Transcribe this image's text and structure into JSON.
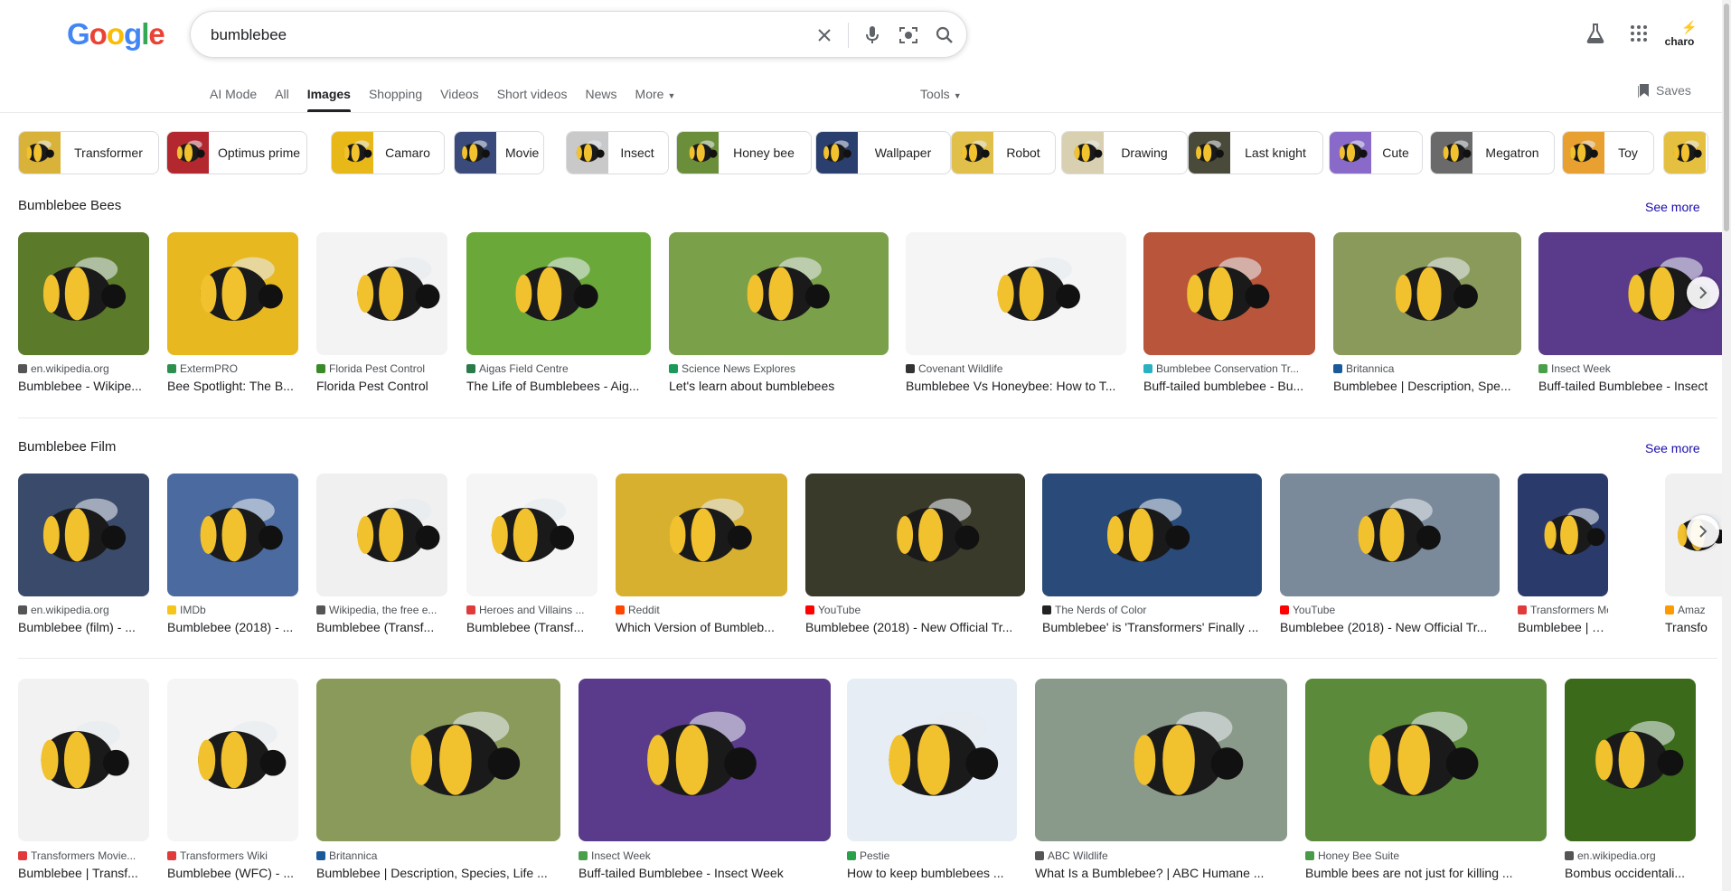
{
  "logo": {
    "letters": [
      "G",
      "o",
      "o",
      "g",
      "l",
      "e"
    ]
  },
  "search": {
    "query": "bumblebee",
    "placeholder": ""
  },
  "header": {
    "profile_text": "charo"
  },
  "tabs": [
    {
      "label": "AI Mode",
      "active": false
    },
    {
      "label": "All",
      "active": false
    },
    {
      "label": "Images",
      "active": true
    },
    {
      "label": "Shopping",
      "active": false
    },
    {
      "label": "Videos",
      "active": false
    },
    {
      "label": "Short videos",
      "active": false
    },
    {
      "label": "News",
      "active": false
    },
    {
      "label": "More",
      "active": false
    }
  ],
  "tools_label": "Tools",
  "saves_label": "Saves",
  "chips": [
    {
      "label": "Transformer",
      "color": "#d9b23a"
    },
    {
      "label": "Optimus prime",
      "color": "#b3272f"
    },
    {
      "label": "Camaro",
      "color": "#e8b818"
    },
    {
      "label": "Movie",
      "color": "#3a4a7a"
    },
    {
      "label": "Insect",
      "color": "#c9c9c9"
    },
    {
      "label": "Honey bee",
      "color": "#6b8e3a"
    },
    {
      "label": "Wallpaper",
      "color": "#2b3f6e"
    },
    {
      "label": "Robot",
      "color": "#e0c04a"
    },
    {
      "label": "Drawing",
      "color": "#d8d0b0"
    },
    {
      "label": "Last knight",
      "color": "#4a4a3a"
    },
    {
      "label": "Cute",
      "color": "#8a6ac9"
    },
    {
      "label": "Megatron",
      "color": "#6a6a6a"
    },
    {
      "label": "Toy",
      "color": "#e8a030"
    },
    {
      "label": "",
      "color": "#e5c040"
    }
  ],
  "section1": {
    "title": "Bumblebee Bees",
    "see_more": "See more",
    "items": [
      {
        "source": "en.wikipedia.org",
        "title": "Bumblebee - Wikipe...",
        "bg": "#5b7a2a",
        "fav": "#555555"
      },
      {
        "source": "ExtermPRO",
        "title": "Bee Spotlight: The B...",
        "bg": "#e8b820",
        "fav": "#2d8f4e"
      },
      {
        "source": "Florida Pest Control",
        "title": "Florida Pest Control",
        "bg": "#f3f3f3",
        "fav": "#3a8a2a"
      },
      {
        "source": "Aigas Field Centre",
        "title": "The Life of Bumblebees - Aig...",
        "bg": "#6aa83a",
        "fav": "#2a7a4a"
      },
      {
        "source": "Science News Explores",
        "title": "Let's learn about bumblebees",
        "bg": "#7aa04a",
        "fav": "#1a9a5a"
      },
      {
        "source": "Covenant Wildlife",
        "title": "Bumblebee Vs Honeybee: How to T...",
        "bg": "#f5f5f5",
        "fav": "#333333"
      },
      {
        "source": "Bumblebee Conservation Tr...",
        "title": "Buff-tailed bumblebee - Bu...",
        "bg": "#b8553a",
        "fav": "#2ab0c0"
      },
      {
        "source": "Britannica",
        "title": "Bumblebee | Description, Spe...",
        "bg": "#8a9a5a",
        "fav": "#1a5a9a"
      },
      {
        "source": "Insect Week",
        "title": "Buff-tailed Bumblebee - Insect",
        "bg": "#5a3a8a",
        "fav": "#4aa04a"
      }
    ]
  },
  "section2": {
    "title": "Bumblebee Film",
    "see_more": "See more",
    "items": [
      {
        "source": "en.wikipedia.org",
        "title": "Bumblebee (film) - ...",
        "bg": "#3a4a6a",
        "fav": "#555555"
      },
      {
        "source": "IMDb",
        "title": "Bumblebee (2018) - ...",
        "bg": "#4a6aa0",
        "fav": "#f5c518"
      },
      {
        "source": "Wikipedia, the free e...",
        "title": "Bumblebee (Transf...",
        "bg": "#f0f0f0",
        "fav": "#555555"
      },
      {
        "source": "Heroes and Villains ...",
        "title": "Bumblebee (Transf...",
        "bg": "#f5f5f5",
        "fav": "#e03a3a"
      },
      {
        "source": "Reddit",
        "title": "Which Version of Bumbleb...",
        "bg": "#d8b030",
        "fav": "#ff4500"
      },
      {
        "source": "YouTube",
        "title": "Bumblebee (2018) - New Official Tr...",
        "bg": "#3a3a2a",
        "fav": "#ff0000"
      },
      {
        "source": "The Nerds of Color",
        "title": "Bumblebee' is 'Transformers' Finally ...",
        "bg": "#2a4a7a",
        "fav": "#222222"
      },
      {
        "source": "YouTube",
        "title": "Bumblebee (2018) - New Official Tr...",
        "bg": "#7a8a9a",
        "fav": "#ff0000"
      },
      {
        "source": "Transformers Movie...",
        "title": "Bumblebee | Transf...",
        "bg": "#2a3a6a",
        "fav": "#e03a3a"
      },
      {
        "source": "Amaz",
        "title": "Transfo",
        "bg": "#f0f0f0",
        "fav": "#ff9900"
      }
    ]
  },
  "section3": {
    "items": [
      {
        "source": "Transformers Movie...",
        "title": "Bumblebee | Transf...",
        "bg": "#f2f2f2",
        "fav": "#e03a3a"
      },
      {
        "source": "Transformers Wiki",
        "title": "Bumblebee (WFC) - ...",
        "bg": "#f5f5f5",
        "fav": "#e03a3a"
      },
      {
        "source": "Britannica",
        "title": "Bumblebee | Description, Species, Life ...",
        "bg": "#8a9a5a",
        "fav": "#1a5a9a"
      },
      {
        "source": "Insect Week",
        "title": "Buff-tailed Bumblebee - Insect Week",
        "bg": "#5a3a8a",
        "fav": "#4aa04a"
      },
      {
        "source": "Pestie",
        "title": "How to keep bumblebees ...",
        "bg": "#e6edf5",
        "fav": "#2aa04a"
      },
      {
        "source": "ABC Wildlife",
        "title": "What Is a Bumblebee? | ABC Humane ...",
        "bg": "#8a9a8a",
        "fav": "#555555"
      },
      {
        "source": "Honey Bee Suite",
        "title": "Bumble bees are not just for killing ...",
        "bg": "#5a8a3a",
        "fav": "#4a9a4a"
      },
      {
        "source": "en.wikipedia.org",
        "title": "Bombus occidentali...",
        "bg": "#3a6a1a",
        "fav": "#555555"
      }
    ]
  }
}
